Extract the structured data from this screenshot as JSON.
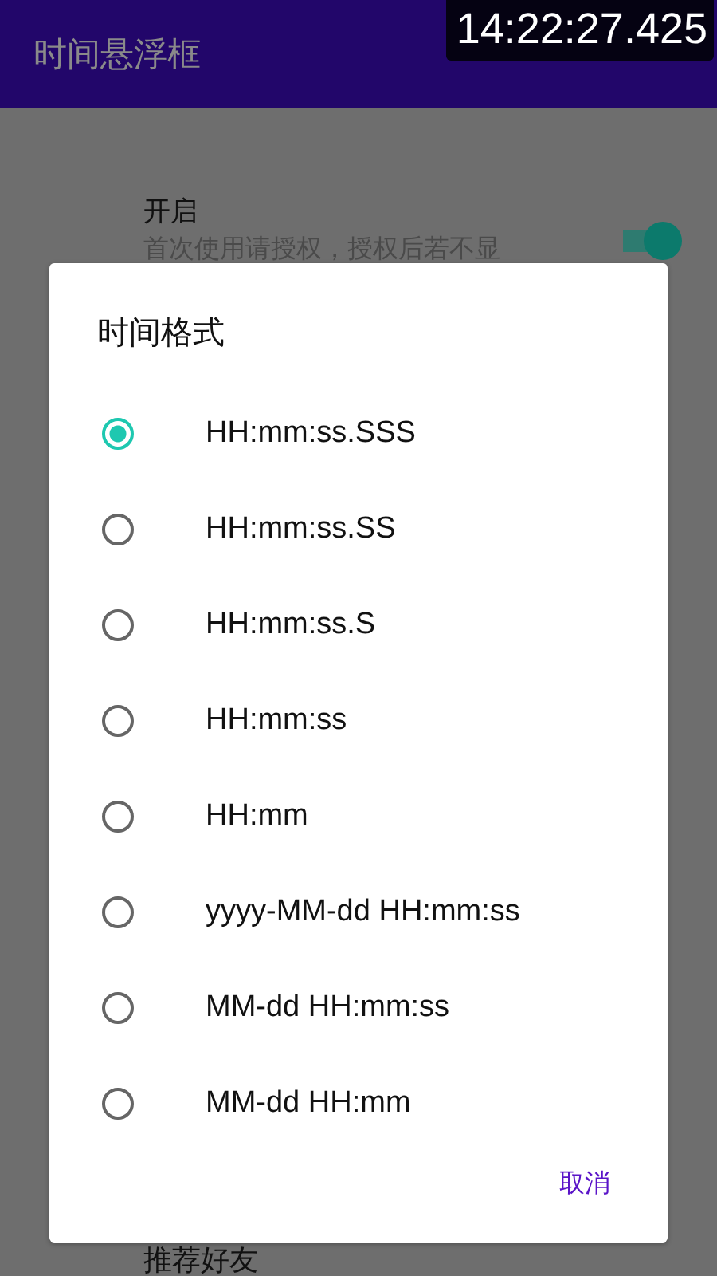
{
  "app_bar": {
    "title": "时间悬浮框"
  },
  "clock_overlay": {
    "time": "14:22:27.425"
  },
  "settings": [
    {
      "title": "开启",
      "subtitle": "首次使用请授权，授权后若不显",
      "on": true
    }
  ],
  "bottom_item": {
    "title": "推荐好友"
  },
  "dialog": {
    "title": "时间格式",
    "options": [
      {
        "label": "HH:mm:ss.SSS",
        "selected": true
      },
      {
        "label": "HH:mm:ss.SS",
        "selected": false
      },
      {
        "label": "HH:mm:ss.S",
        "selected": false
      },
      {
        "label": "HH:mm:ss",
        "selected": false
      },
      {
        "label": "HH:mm",
        "selected": false
      },
      {
        "label": "yyyy-MM-dd HH:mm:ss",
        "selected": false
      },
      {
        "label": "MM-dd HH:mm:ss",
        "selected": false
      },
      {
        "label": "MM-dd HH:mm",
        "selected": false
      }
    ],
    "buttons": [
      "取消"
    ]
  }
}
